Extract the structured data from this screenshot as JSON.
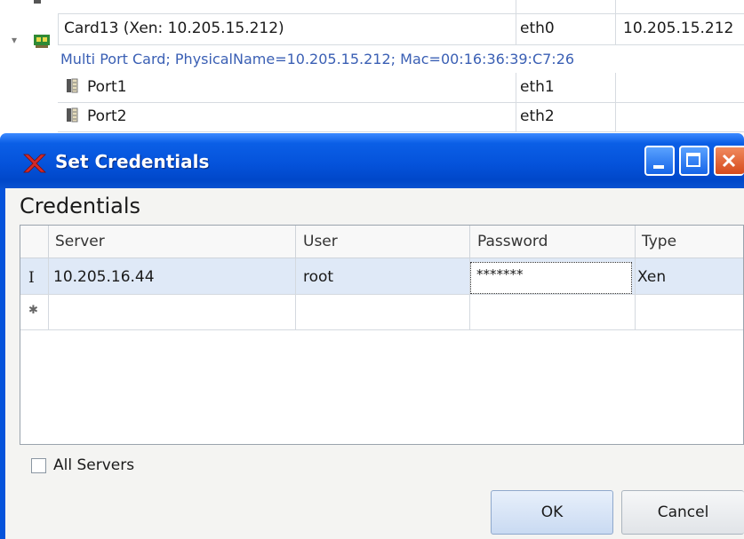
{
  "tree": {
    "card_title": "Card13 (Xen: 10.205.15.212)",
    "card_iface": "eth0",
    "card_ip": "10.205.15.212",
    "card_desc": "Multi Port Card; PhysicalName=10.205.15.212; Mac=00:16:36:39:C7:26",
    "ports": [
      {
        "name": "Port1",
        "iface": "eth1"
      },
      {
        "name": "Port2",
        "iface": "eth2"
      }
    ]
  },
  "dialog": {
    "title": "Set Credentials",
    "heading": "Credentials",
    "columns": [
      "Server",
      "User",
      "Password",
      "Type"
    ],
    "rows": [
      {
        "indicator": "I",
        "server": "10.205.16.44",
        "user": "root",
        "password": "*******",
        "type": "Xen"
      }
    ],
    "new_row_indicator": "✱",
    "all_servers_label": "All Servers",
    "ok_label": "OK",
    "cancel_label": "Cancel"
  },
  "colors": {
    "title_bar": "#0553db",
    "selected_row": "#dfe9f7",
    "link_text": "#3a5fb4"
  }
}
